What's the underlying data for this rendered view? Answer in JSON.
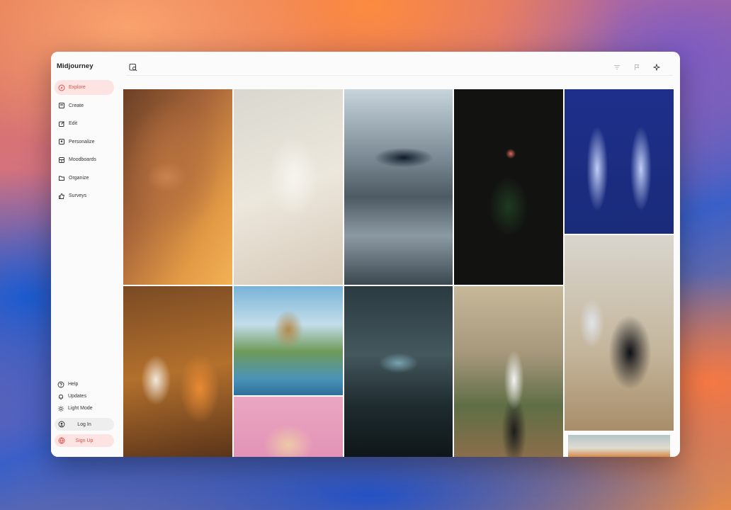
{
  "app": {
    "title": "Midjourney"
  },
  "nav": {
    "items": [
      {
        "label": "Explore",
        "icon": "compass-icon",
        "active": true
      },
      {
        "label": "Create",
        "icon": "pencil-icon",
        "active": false
      },
      {
        "label": "Edit",
        "icon": "edit-icon",
        "active": false
      },
      {
        "label": "Personalize",
        "icon": "personalize-icon",
        "active": false
      },
      {
        "label": "Moodboards",
        "icon": "moodboard-icon",
        "active": false
      },
      {
        "label": "Organize",
        "icon": "folder-icon",
        "active": false
      },
      {
        "label": "Surveys",
        "icon": "thumbs-up-icon",
        "active": false
      }
    ]
  },
  "bottom": {
    "help": "Help",
    "updates": "Updates",
    "light_mode": "Light Mode",
    "login": "Log In",
    "signup": "Sign Up"
  },
  "search": {
    "placeholder": ""
  },
  "colors": {
    "accent": "#e0544c",
    "accent_bg": "#fde3e1"
  },
  "gallery": {
    "tiles": [
      {
        "name": "portrait-freckles-tile"
      },
      {
        "name": "floating-phone-ui-tile"
      },
      {
        "name": "orca-mall-tile"
      },
      {
        "name": "rose-dark-tile"
      },
      {
        "name": "ghost-couple-tile"
      },
      {
        "name": "serum-bottles-tile"
      },
      {
        "name": "anime-adventurer-tile"
      },
      {
        "name": "scifi-cockpit-tile"
      },
      {
        "name": "woman-cafe-tile"
      },
      {
        "name": "panther-motorbike-tile"
      },
      {
        "name": "pink-hair-portrait-tile"
      },
      {
        "name": "partial-next-tile"
      }
    ]
  }
}
